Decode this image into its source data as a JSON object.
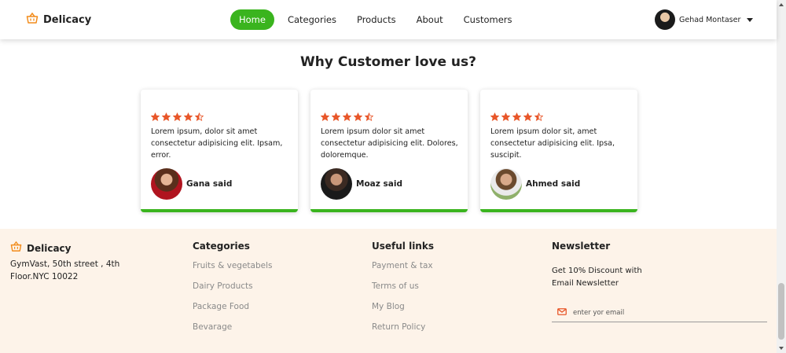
{
  "brand": {
    "name": "Delicacy",
    "icon": "basket-icon"
  },
  "nav": {
    "links": [
      "Home",
      "Categories",
      "Products",
      "About",
      "Customers"
    ],
    "active": "Home"
  },
  "user": {
    "name": "Gehad Montaser"
  },
  "section": {
    "title": "Why Customer love us?"
  },
  "testimonials": [
    {
      "rating": 4.5,
      "text": "Lorem ipsum, dolor sit amet consectetur adipisicing elit. Ipsam, error.",
      "name": "Gana said"
    },
    {
      "rating": 4.5,
      "text": "Lorem ipsum dolor sit amet consectetur adipisicing elit. Dolores, doloremque.",
      "name": "Moaz said"
    },
    {
      "rating": 4.5,
      "text": "Lorem ipsum dolor sit, amet consectetur adipisicing elit. Ipsa, suscipit.",
      "name": "Ahmed said"
    }
  ],
  "footer": {
    "brand": "Delicacy",
    "address": "GymVast, 50th street , 4th Floor.NYC 10022",
    "categories": {
      "title": "Categories",
      "items": [
        "Fruits & vegetabels",
        "Dairy Products",
        "Package Food",
        "Bevarage"
      ]
    },
    "links": {
      "title": "Useful links",
      "items": [
        "Payment & tax",
        "Terms of us",
        "My Blog",
        "Return Policy"
      ]
    },
    "newsletter": {
      "title": "Newsletter",
      "text": "Get 10% Discount with Email Newsletter",
      "placeholder": "enter yor email"
    }
  },
  "colors": {
    "accent": "#3ab41e",
    "star": "#e8572a",
    "basket": "#f28c1b",
    "footer_bg": "#fdf3e9"
  }
}
